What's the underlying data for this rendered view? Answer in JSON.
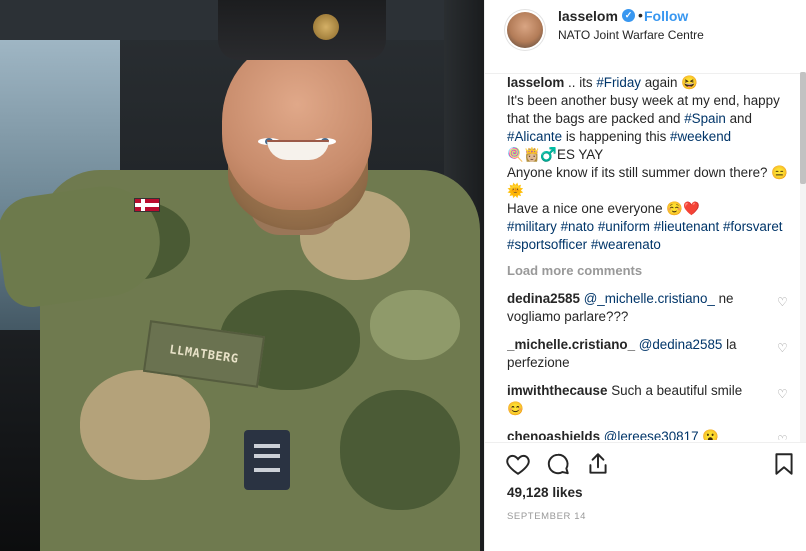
{
  "photo": {
    "nametape": "LLMATBERG"
  },
  "header": {
    "username": "lasselom",
    "verified_icon": "verified-check-icon",
    "separator": "•",
    "follow_label": "Follow",
    "location": "NATO Joint Warfare Centre"
  },
  "caption": {
    "username": "lasselom",
    "line1_pre": " .. its ",
    "tag_friday": "#Friday",
    "line1_post": " again 😆",
    "line2": "It's been another busy week at my end, happy that the bags are packed and ",
    "tag_spain": "#Spain",
    "and": " and ",
    "tag_alicante": "#Alicante",
    "line3": " is happening this ",
    "tag_weekend": "#weekend",
    "line4": "🍭👸🏼♂️ES YAY",
    "line5": "Anyone know if its still summer down there? 😑🌞",
    "line6": "Have a nice one everyone ☺️❤️",
    "hashtags": [
      "#military",
      "#nato",
      "#uniform",
      "#lieutenant",
      "#forsvaret",
      "#sportsofficer",
      "#wearenato"
    ]
  },
  "load_more": "Load more comments",
  "comments": [
    {
      "user": "dedina2585",
      "mention": "@_michelle.cristiano_",
      "text": " ne vogliamo parlare???"
    },
    {
      "user": "_michelle.cristiano_",
      "mention": "@dedina2585",
      "text": " la perfezione"
    },
    {
      "user": "imwiththecause",
      "mention": "",
      "text": "Such a beautiful smile 😊"
    },
    {
      "user": "chenoashields",
      "mention": "@lereese30817",
      "text": " 😮"
    }
  ],
  "likes": "49,128 likes",
  "date": "SEPTEMBER 14",
  "colors": {
    "accent": "#3897f0",
    "hashtag": "#003569",
    "muted": "#999999"
  }
}
